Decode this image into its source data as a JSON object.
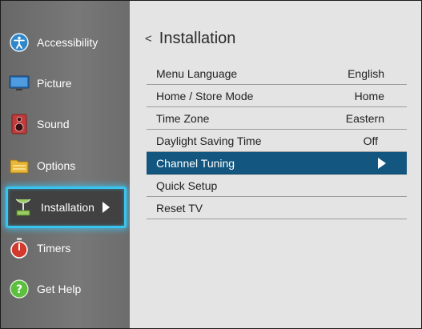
{
  "sidebar": {
    "items": [
      {
        "label": "Accessibility",
        "icon": "accessibility-icon"
      },
      {
        "label": "Picture",
        "icon": "picture-monitor-icon"
      },
      {
        "label": "Sound",
        "icon": "speaker-icon"
      },
      {
        "label": "Options",
        "icon": "options-folder-icon"
      },
      {
        "label": "Installation",
        "icon": "installation-satellite-icon",
        "selected": true
      },
      {
        "label": "Timers",
        "icon": "timer-icon"
      },
      {
        "label": "Get Help",
        "icon": "help-icon"
      }
    ]
  },
  "panel": {
    "back_glyph": "<",
    "title": "Installation",
    "rows": [
      {
        "label": "Menu Language",
        "value": "English"
      },
      {
        "label": "Home / Store Mode",
        "value": "Home"
      },
      {
        "label": "Time Zone",
        "value": "Eastern"
      },
      {
        "label": "Daylight Saving Time",
        "value": "Off"
      },
      {
        "label": "Channel Tuning",
        "value": "",
        "highlighted": true
      },
      {
        "label": "Quick Setup",
        "value": ""
      },
      {
        "label": "Reset TV",
        "value": ""
      }
    ]
  },
  "colors": {
    "selection_glow": "#39c3ef",
    "row_highlight": "#13567f",
    "sidebar_bg": "#707070",
    "panel_bg": "#e4e4e4"
  }
}
